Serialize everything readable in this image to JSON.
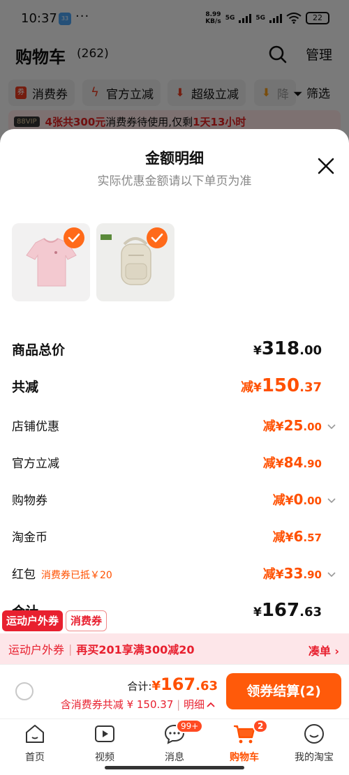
{
  "status_bar": {
    "time": "10:37",
    "app_badge": "33",
    "more": "···",
    "speed_value": "8.99",
    "speed_unit": "KB/s",
    "network_1": "5G",
    "network_2": "5G",
    "battery": "22"
  },
  "cart_header": {
    "title": "购物车",
    "count": "(262)",
    "manage_label": "管理"
  },
  "filter_chips": [
    {
      "label": "消费券"
    },
    {
      "label": "官方立减"
    },
    {
      "label": "超级立减"
    },
    {
      "label": "降"
    }
  ],
  "filter_button": "筛选",
  "vip_banner": {
    "tag": "88VIP",
    "part1": "4张共300元",
    "part2": "消费券待使用,仅剩",
    "part3": "1天13小时"
  },
  "sheet": {
    "title": "金额明细",
    "subtitle": "实际优惠金额请以下单页为准"
  },
  "summary": {
    "total_price": {
      "label": "商品总价",
      "yen": "¥",
      "int": "318",
      "dec": ".00"
    },
    "total_reduction": {
      "label": "共减",
      "prefix": "减",
      "yen": "¥",
      "int": "150",
      "dec": ".37"
    },
    "items": [
      {
        "label": "店铺优惠",
        "prefix": "减",
        "yen": "¥",
        "int": "25",
        "dec": ".00"
      },
      {
        "label": "官方立减",
        "prefix": "减",
        "yen": "¥",
        "int": "84",
        "dec": ".90"
      },
      {
        "label": "购物券",
        "prefix": "减",
        "yen": "¥",
        "int": "0",
        "dec": ".00"
      },
      {
        "label": "淘金币",
        "prefix": "减",
        "yen": "¥",
        "int": "6",
        "dec": ".57"
      },
      {
        "label": "红包",
        "note": "消费券已抵￥20",
        "prefix": "减",
        "yen": "¥",
        "int": "33",
        "dec": ".90"
      }
    ],
    "total": {
      "label": "合计",
      "yen": "¥",
      "int": "167",
      "dec": ".63"
    }
  },
  "float_tags": {
    "sports": "运动户外券",
    "consumer": "消费券"
  },
  "promo": {
    "name": "运动户外券",
    "text": "再买201享满300减20",
    "link": "凑单"
  },
  "checkout": {
    "total_label": "合计:",
    "total_yen": "¥",
    "total_int": "167",
    "total_dec": ".63",
    "discount_text": "含消费券共减 ¥ 150.37",
    "detail_toggle": "明细",
    "button_label": "领券结算(2)"
  },
  "tabs": [
    {
      "label": "首页"
    },
    {
      "label": "视频"
    },
    {
      "label": "消息",
      "badge": "99+"
    },
    {
      "label": "购物车",
      "badge": "2"
    },
    {
      "label": "我的淘宝"
    }
  ],
  "colors": {
    "accent": "#ff5000",
    "promo_red": "#e8202f",
    "check_orange": "#ff6a1a"
  }
}
